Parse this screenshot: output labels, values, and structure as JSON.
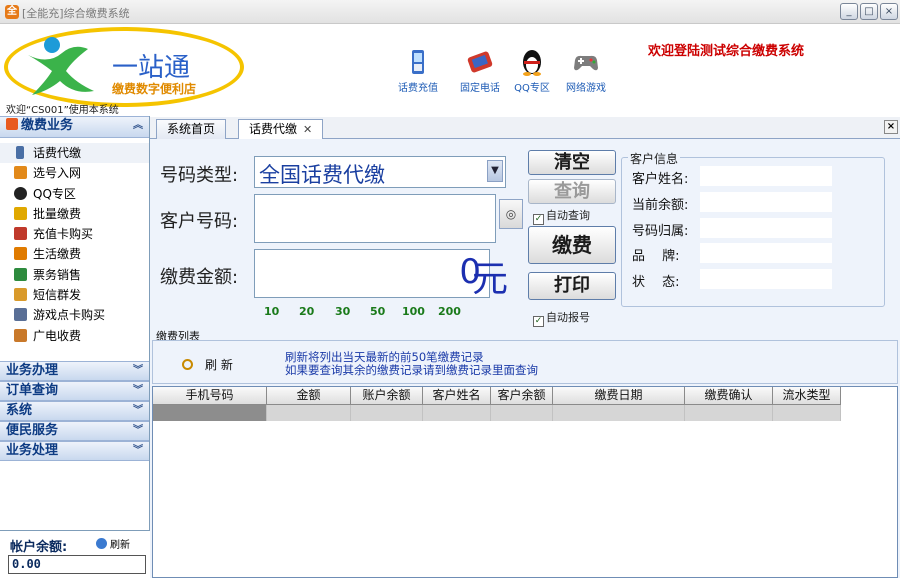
{
  "window": {
    "title": "[全能充]综合缴费系统"
  },
  "header": {
    "logo_brand": "一站通",
    "logo_sub": "缴费数字便利店",
    "welcome_user": "欢迎“CS001”使用本系统",
    "banner": "欢迎登陆测试综合缴费系统",
    "toolbar": [
      {
        "label": "话费充值",
        "icon": "phone-icon"
      },
      {
        "label": "固定电话",
        "icon": "landline-icon"
      },
      {
        "label": "QQ专区",
        "icon": "qq-penguin-icon"
      },
      {
        "label": "网络游戏",
        "icon": "gamepad-icon"
      }
    ]
  },
  "sidebar": {
    "section_main": "缴费业务",
    "items": [
      {
        "label": "话费代缴",
        "icon": "mobile-icon",
        "color": "#4a6fa5"
      },
      {
        "label": "选号入网",
        "icon": "sim-icon",
        "color": "#e2891a"
      },
      {
        "label": "QQ专区",
        "icon": "qq-icon",
        "color": "#222222"
      },
      {
        "label": "批量缴费",
        "icon": "batch-icon",
        "color": "#e0a800"
      },
      {
        "label": "充值卡购买",
        "icon": "card-icon",
        "color": "#c0392b"
      },
      {
        "label": "生活缴费",
        "icon": "life-icon",
        "color": "#e07b00"
      },
      {
        "label": "票务销售",
        "icon": "ticket-icon",
        "color": "#2e8b3e"
      },
      {
        "label": "短信群发",
        "icon": "sms-icon",
        "color": "#d99a2b"
      },
      {
        "label": "游戏点卡购买",
        "icon": "game-card-icon",
        "color": "#5a6f96"
      },
      {
        "label": "广电收费",
        "icon": "tv-icon",
        "color": "#c9792a"
      }
    ],
    "sections": [
      "业务办理",
      "订单查询",
      "系统",
      "便民服务",
      "业务处理"
    ],
    "account_label": "帐户余额:",
    "account_refresh": "刷新",
    "account_value": "0.00"
  },
  "tabs": [
    {
      "label": "系统首页",
      "active": false
    },
    {
      "label": "话费代缴",
      "active": true
    }
  ],
  "form": {
    "type_label": "号码类型:",
    "type_value": "全国话费代缴",
    "number_label": "客户号码:",
    "number_value": "",
    "amount_label": "缴费金额:",
    "amount_value": "0",
    "currency": "元",
    "quick_amounts": [
      "10",
      "20",
      "30",
      "50",
      "100",
      "200"
    ]
  },
  "buttons": {
    "clear": "清空",
    "query": "查询",
    "auto_query": "自动查询",
    "pay": "缴费",
    "print": "打印",
    "auto_report": "自动报号"
  },
  "customer": {
    "legend": "客户信息",
    "fields": [
      {
        "label": "客户姓名:",
        "value": ""
      },
      {
        "label": "当前余额:",
        "value": ""
      },
      {
        "label": "号码归属:",
        "value": ""
      },
      {
        "label": "品　 牌:",
        "value": ""
      },
      {
        "label": "状　 态:",
        "value": ""
      }
    ]
  },
  "list": {
    "legend": "缴费列表",
    "refresh": "刷 新",
    "note_line1": "刷新将列出当天最新的前50笔缴费记录",
    "note_line2": "如果要查询其余的缴费记录请到缴费记录里面查询",
    "columns": [
      "手机号码",
      "金额",
      "账户余额",
      "客户姓名",
      "客户余额",
      "缴费日期",
      "缴费确认",
      "流水类型"
    ]
  }
}
